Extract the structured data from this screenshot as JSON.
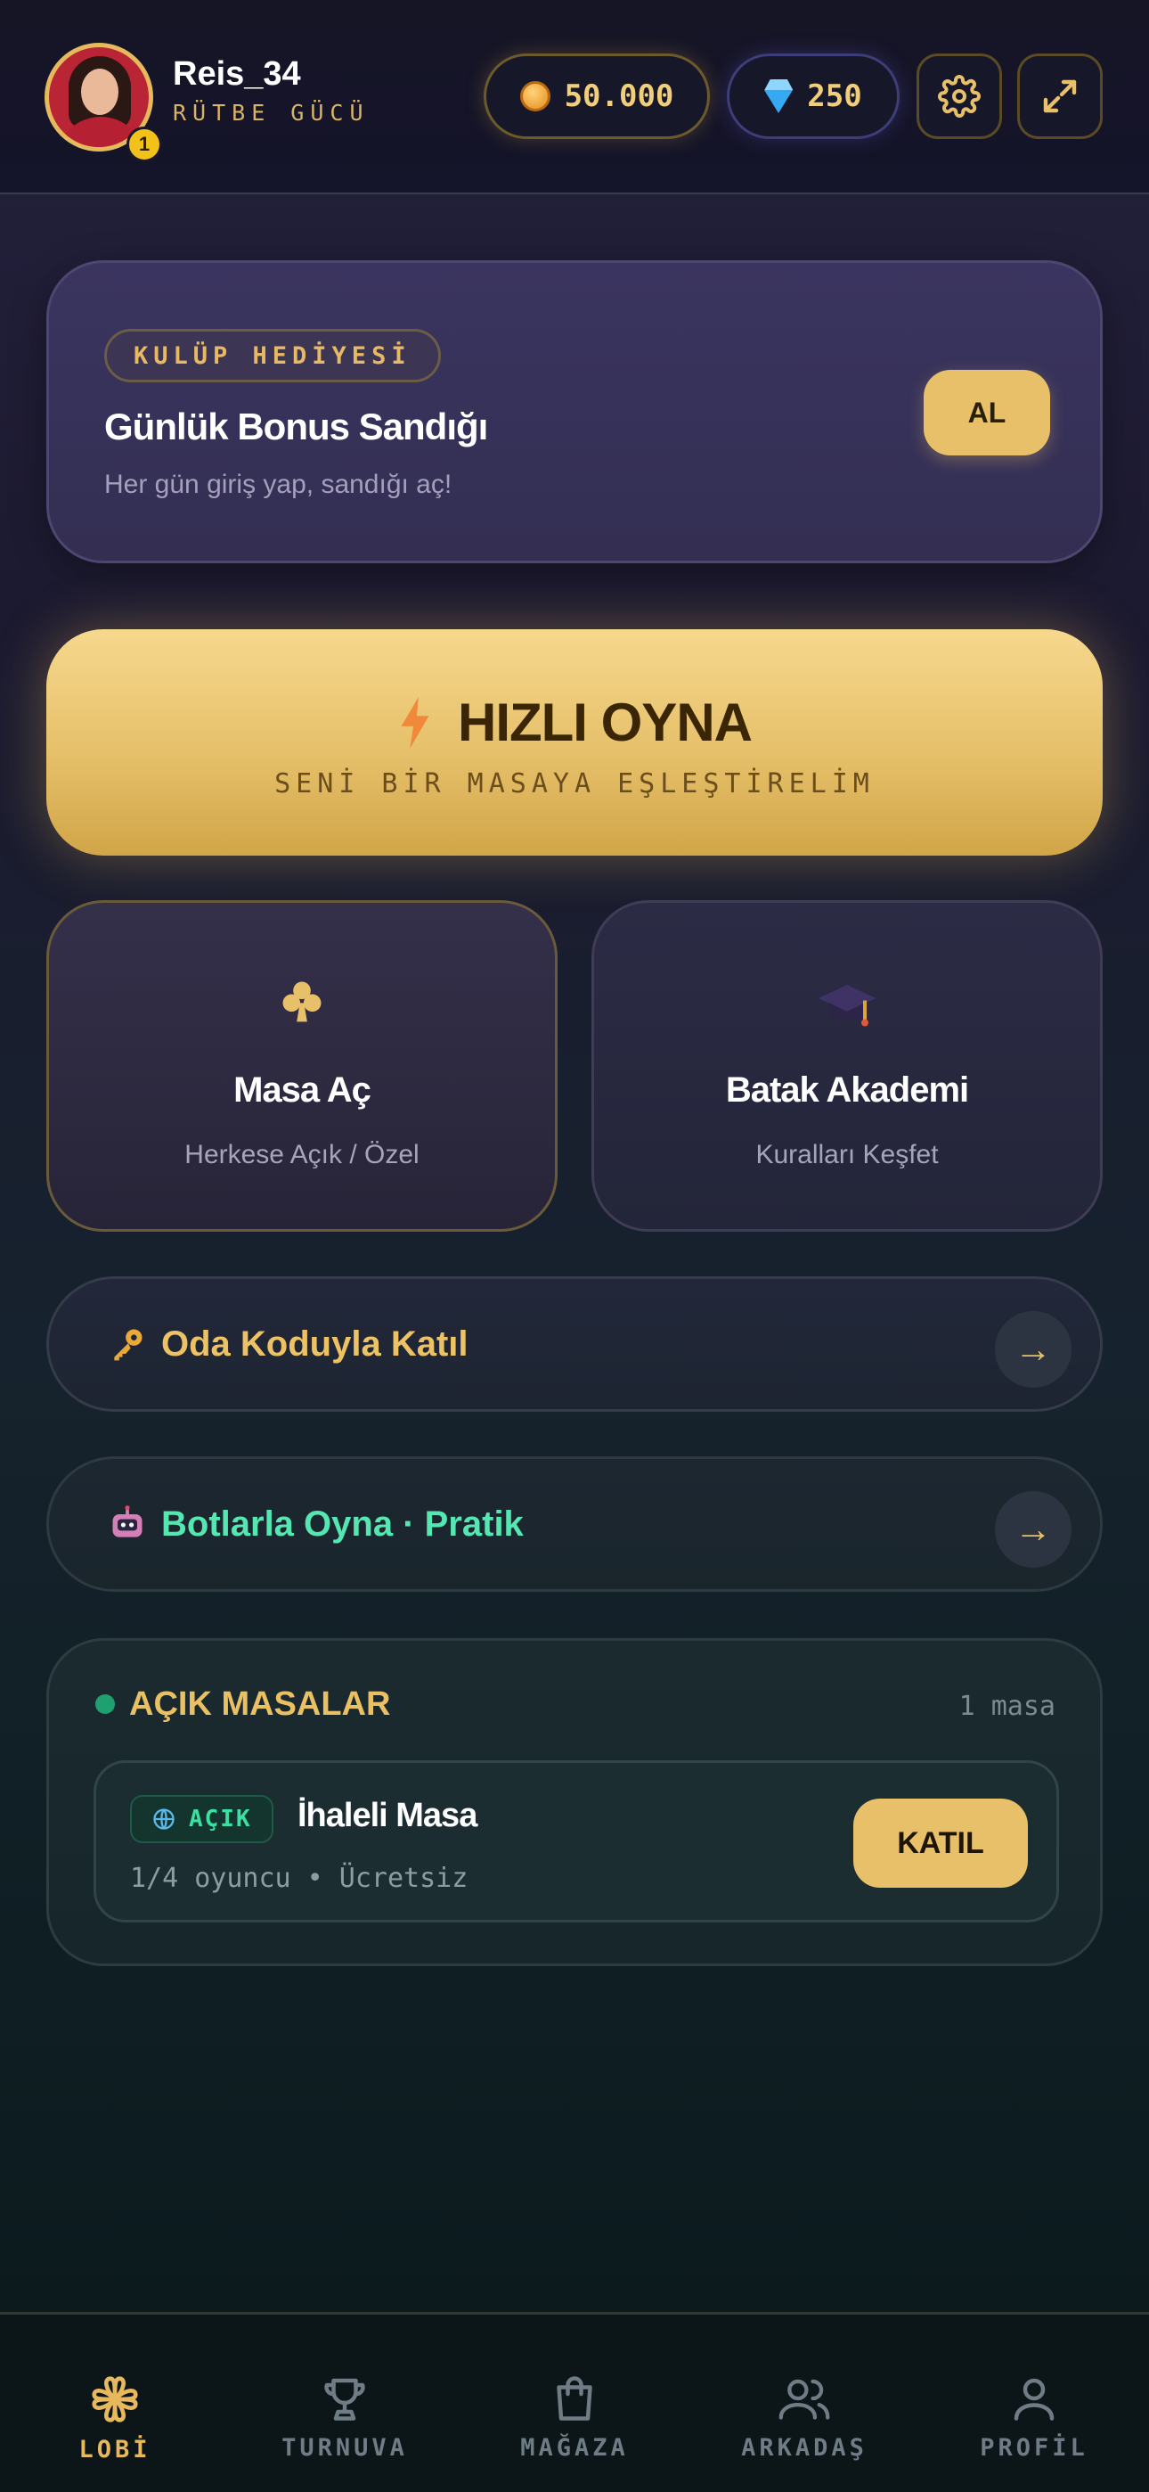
{
  "header": {
    "username": "Reis_34",
    "rank_label": "RÜTBE GÜCÜ",
    "level": "1",
    "coins": "50.000",
    "gems": "250"
  },
  "bonus": {
    "tag": "KULÜP HEDİYESİ",
    "title": "Günlük Bonus Sandığı",
    "subtitle": "Her gün giriş yap, sandığı aç!",
    "button": "AL"
  },
  "quick_play": {
    "title": "HIZLI OYNA",
    "subtitle": "SENİ BİR MASAYA EŞLEŞTİRELİM"
  },
  "cards": [
    {
      "title": "Masa Aç",
      "subtitle": "Herkese Açık / Özel",
      "icon": "club-icon"
    },
    {
      "title": "Batak Akademi",
      "subtitle": "Kuralları Keşfet",
      "icon": "graduation-cap-icon"
    }
  ],
  "rows": {
    "room_code": "Oda Koduyla Katıl",
    "bots": "Botlarla Oyna · Pratik",
    "arrow": "→"
  },
  "open_tables": {
    "title": "AÇIK MASALAR",
    "count": "1 masa",
    "items": [
      {
        "status": "AÇIK",
        "name": "İhaleli Masa",
        "meta": "1/4 oyuncu • Ücretsiz",
        "button": "KATIL"
      }
    ]
  },
  "nav": [
    {
      "label": "LOBİ",
      "icon": "clover-icon",
      "active": true
    },
    {
      "label": "TURNUVA",
      "icon": "trophy-icon",
      "active": false
    },
    {
      "label": "MAĞAZA",
      "icon": "bag-icon",
      "active": false
    },
    {
      "label": "ARKADAŞ",
      "icon": "friends-icon",
      "active": false
    },
    {
      "label": "PROFİL",
      "icon": "user-icon",
      "active": false
    }
  ],
  "colors": {
    "accent_gold": "#e8c06a",
    "status_green": "#3ce0a2",
    "bots_green": "#55e6b2"
  }
}
